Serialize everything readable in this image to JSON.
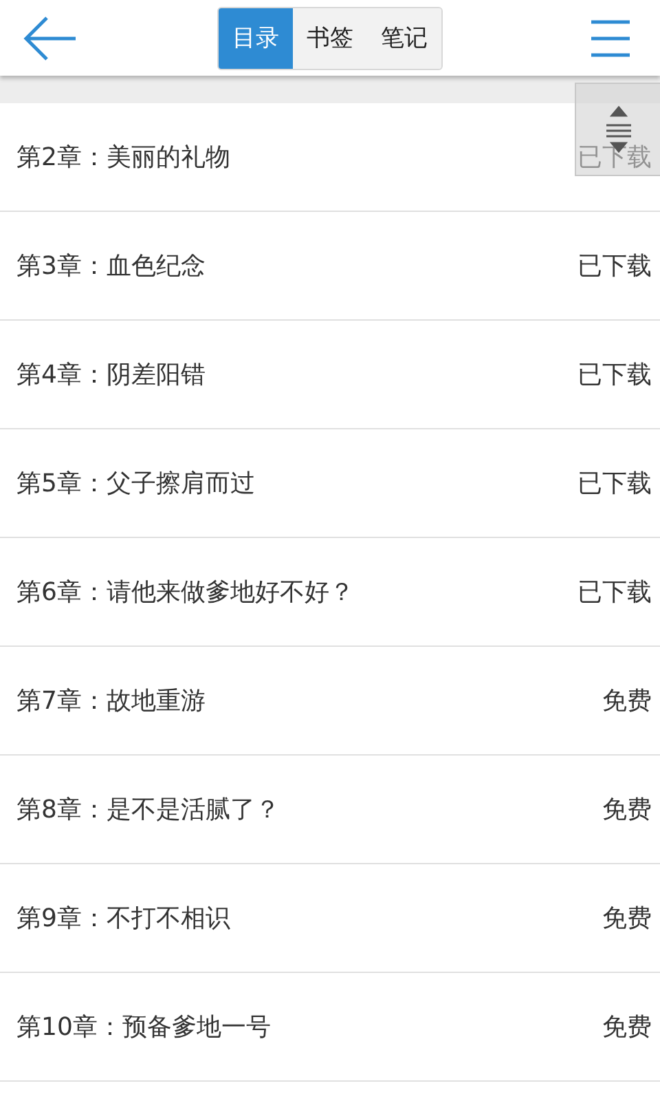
{
  "tabs": [
    {
      "label": "目录",
      "selected": true
    },
    {
      "label": "书签",
      "selected": false
    },
    {
      "label": "笔记",
      "selected": false
    }
  ],
  "chapters": [
    {
      "title": "第2章：美丽的礼物",
      "status": "已下载"
    },
    {
      "title": "第3章：血色纪念",
      "status": "已下载"
    },
    {
      "title": "第4章：阴差阳错",
      "status": "已下载"
    },
    {
      "title": "第5章：父子擦肩而过",
      "status": "已下载"
    },
    {
      "title": "第6章：请他来做爹地好不好？",
      "status": "已下载"
    },
    {
      "title": "第7章：故地重游",
      "status": "免费"
    },
    {
      "title": "第8章：是不是活腻了？",
      "status": "免费"
    },
    {
      "title": "第9章：不打不相识",
      "status": "免费"
    },
    {
      "title": "第10章：预备爹地一号",
      "status": "免费"
    }
  ]
}
